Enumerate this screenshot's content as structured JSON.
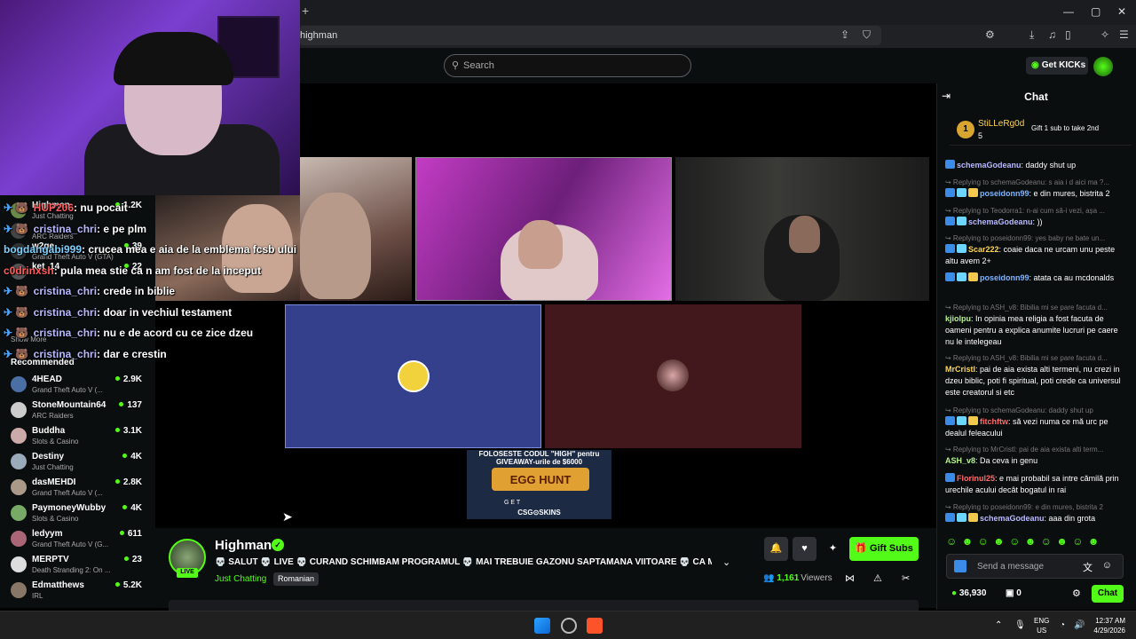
{
  "browser": {
    "new_tab_symbol": "+",
    "url": "highman",
    "window_controls": [
      "—",
      "▢",
      "✕"
    ]
  },
  "header": {
    "search_placeholder": "Search",
    "get_kicks_label": "Get KICKs"
  },
  "overlay_chat": [
    {
      "badges": "✈ 🐻 ",
      "user": "HUP206",
      "user_color": "u3",
      "sep": ": ",
      "text": "nu pocait"
    },
    {
      "badges": "✈ 🐻 ",
      "user": "cristina_chri",
      "user_color": "u1",
      "sep": ": ",
      "text": "e pe plm"
    },
    {
      "badges": "",
      "user": "bogdangabi999",
      "user_color": "u2",
      "sep": ": ",
      "text": "crucea mea e aia de la emblema fcsb ului"
    },
    {
      "badges": "",
      "user": "c0drinxsh",
      "user_color": "u3",
      "sep": ": ",
      "text": "pula mea stie ca n am fost de la inceput"
    },
    {
      "badges": "✈ 🐻 ",
      "user": "cristina_chri",
      "user_color": "u1",
      "sep": ": ",
      "text": "crede in biblie"
    },
    {
      "badges": "✈ 🐻 ",
      "user": "cristina_chri",
      "user_color": "u1",
      "sep": ": ",
      "text": "doar in vechiul testament"
    },
    {
      "badges": "✈ 🐻 ",
      "user": "cristina_chri",
      "user_color": "u1",
      "sep": ": ",
      "text": "nu e de acord cu ce zice dzeu"
    },
    {
      "badges": "✈ 🐻 ",
      "user": "cristina_chri",
      "user_color": "u1",
      "sep": ": ",
      "text": "dar e crestin"
    }
  ],
  "sidebar": {
    "following": [
      {
        "name": "Highman",
        "category": "Just Chatting",
        "viewers": "1.2K",
        "color": "#6a8a4a"
      },
      {
        "name": "",
        "category": "ARC Raiders",
        "viewers": "",
        "color": "#444"
      },
      {
        "name": "w2ge",
        "category": "Grand Theft Auto V (GTA)",
        "viewers": "39",
        "color": "#333"
      },
      {
        "name": "ket_14",
        "category": "",
        "viewers": "22",
        "color": "#555"
      }
    ],
    "show_more": "Show More",
    "recommended_label": "Recommended",
    "recommended": [
      {
        "name": "4HEAD",
        "category": "Grand Theft Auto V (...",
        "viewers": "2.9K",
        "color": "#4a6fa5"
      },
      {
        "name": "StoneMountain64",
        "category": "ARC Raiders",
        "viewers": "137",
        "color": "#ccc"
      },
      {
        "name": "Buddha",
        "category": "Slots & Casino",
        "viewers": "3.1K",
        "color": "#caa"
      },
      {
        "name": "Destiny",
        "category": "Just Chatting",
        "viewers": "4K",
        "color": "#9ab"
      },
      {
        "name": "dasMEHDI",
        "category": "Grand Theft Auto V (...",
        "viewers": "2.8K",
        "color": "#a98"
      },
      {
        "name": "PaymoneyWubby",
        "category": "Slots & Casino",
        "viewers": "4K",
        "color": "#7a6"
      },
      {
        "name": "ledyym",
        "category": "Grand Theft Auto V (G...",
        "viewers": "611",
        "color": "#a67"
      },
      {
        "name": "MERPTV",
        "category": "Death Stranding 2: On ...",
        "viewers": "23",
        "color": "#ddd"
      },
      {
        "name": "Edmatthews",
        "category": "IRL",
        "viewers": "5.2K",
        "color": "#876"
      }
    ]
  },
  "ad": {
    "line1": "FOLOSESTE CODUL \"HIGH\" pentru GIVEAWAY-urile de $6000",
    "banner": "EGG HUNT",
    "get": "G E T",
    "brand": "CSG⊙SKINS"
  },
  "channel": {
    "name": "Highman",
    "live_label": "LIVE",
    "title": "💀 SALUT 💀 LIVE 💀 CURAND SCHIMBAM PROGRAMUL 💀 MAI TREBUIE GAZONU SAPTAMANA VIITOARE 💀 CA MAINE PLO...",
    "category": "Just Chatting",
    "tag": "Romanian",
    "gift_subs_label": "Gift Subs",
    "viewers_count": "1,161",
    "viewers_label": "Viewers"
  },
  "chat": {
    "title": "Chat",
    "pinned": {
      "rank": "1",
      "name": "StiLLeRg0d",
      "count": "5",
      "gift_text": "Gift 1 sub to take 2nd"
    },
    "messages": [
      {
        "reply": "",
        "user": "schemaGodeanu",
        "color": "#b9b9ff",
        "badges": [
          "b"
        ],
        "text": "daddy shut up"
      },
      {
        "reply": "↪ Replying to schemaGodeanu: s aia i d aici ma ?...",
        "user": "poseidonn99",
        "color": "#7cb4ff",
        "badges": [
          "b",
          "b2",
          "b3"
        ],
        "text": "e din mures, bistrita 2"
      },
      {
        "reply": "↪ Replying to Teodorra1: n-ai cum să-i vezi, așa ...",
        "user": "schemaGodeanu",
        "color": "#b9b9ff",
        "badges": [
          "b",
          "b2"
        ],
        "text": "))"
      },
      {
        "reply": "↪ Replying to poseidonn99: yes baby ne bate un...",
        "user": "Scar222",
        "color": "#ffd54f",
        "badges": [
          "b",
          "b2"
        ],
        "text": "coaie daca ne urcam unu peste altu avem 2+"
      },
      {
        "reply": "",
        "user": "poseidonn99",
        "color": "#7cb4ff",
        "badges": [
          "b",
          "b2",
          "b3"
        ],
        "text": "atata ca au mcdonalds"
      },
      {
        "reply": "↪ Replying to ASH_v8: Bibilia mi se pare facuta d...",
        "user": "kjiolpu",
        "color": "#b7f28c",
        "badges": [],
        "text": "In opinia mea religia a fost facuta de oameni pentru a explica anumite lucruri pe caere nu le intelegeau"
      },
      {
        "reply": "↪ Replying to ASH_v8: Bibilia mi se pare facuta d...",
        "user": "MrCristl",
        "color": "#ffd54f",
        "badges": [],
        "text": "pai de aia exista alti termeni, nu crezi in dzeu biblic, poti fi spiritual, poti crede ca universul este creatorul si etc"
      },
      {
        "reply": "↪ Replying to schemaGodeanu: daddy shut up",
        "user": "fitchftw",
        "color": "#ff6b6b",
        "badges": [
          "b",
          "b2",
          "b3"
        ],
        "text": "să vezi numa ce mă urc pe dealul feleacului"
      },
      {
        "reply": "↪ Replying to MrCristl: pai de aia exista alti term...",
        "user": "ASH_v8",
        "color": "#b7f28c",
        "badges": [],
        "text": "Da ceva in genu"
      },
      {
        "reply": "",
        "user": "Florinul25",
        "color": "#ff6b6b",
        "badges": [
          "b"
        ],
        "text": "e mai probabil sa intre cămilă prin urechile acului decât bogatul in rai"
      },
      {
        "reply": "↪ Replying to poseidonn99: e din mures, bistrita 2",
        "user": "schemaGodeanu",
        "color": "#b9b9ff",
        "badges": [
          "b",
          "b2",
          "b3"
        ],
        "text": "aaa din grota"
      }
    ],
    "emotes": "☺ ☻ ☺ ☻ ☺ ☻ ☺ ☻ ☺ ☻",
    "send_placeholder": "Send a message",
    "kicks_balance": "36,930",
    "points": "0",
    "chat_button": "Chat"
  },
  "taskbar": {
    "lang1": "ENG",
    "lang2": "US",
    "time": "12:37 AM",
    "date": "4/29/2026"
  }
}
